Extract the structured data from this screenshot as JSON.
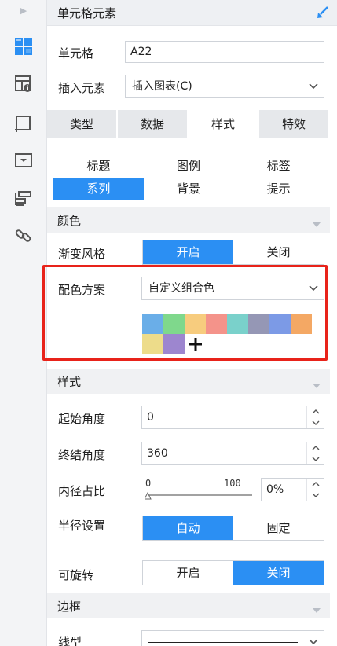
{
  "rail": {
    "icons": [
      "collapse-arrow-icon",
      "cell-grid-icon",
      "cell-attribute-icon",
      "widget-frame-icon",
      "form-element-icon",
      "layout-stack-icon",
      "link-icon"
    ]
  },
  "header": {
    "title": "单元格元素"
  },
  "cell": {
    "label": "单元格",
    "value": "A22"
  },
  "insert": {
    "label": "插入元素",
    "value": "插入图表(C)"
  },
  "main_tabs": [
    {
      "label": "类型",
      "active": false
    },
    {
      "label": "数据",
      "active": false
    },
    {
      "label": "样式",
      "active": true
    },
    {
      "label": "特效",
      "active": false
    }
  ],
  "sub_tabs": [
    {
      "label": "标题",
      "active": false
    },
    {
      "label": "图例",
      "active": false
    },
    {
      "label": "标签",
      "active": false
    },
    {
      "label": "系列",
      "active": true
    },
    {
      "label": "背景",
      "active": false
    },
    {
      "label": "提示",
      "active": false
    }
  ],
  "color_section": {
    "title": "颜色"
  },
  "gradient": {
    "label": "渐变风格",
    "on": "开启",
    "off": "关闭",
    "selected": "on"
  },
  "scheme": {
    "label": "配色方案",
    "value": "自定义组合色"
  },
  "palette": [
    "#6aaee8",
    "#7fd88c",
    "#f7cc7e",
    "#f4938a",
    "#7ad1cb",
    "#9597b5",
    "#7c9ae6",
    "#f4a864",
    "#eddc8a",
    "#9d86cf"
  ],
  "style_section": {
    "title": "样式"
  },
  "start_angle": {
    "label": "起始角度",
    "value": "0"
  },
  "end_angle": {
    "label": "终结角度",
    "value": "360"
  },
  "inner_radius": {
    "label": "内径占比",
    "min": "0",
    "max": "100",
    "value": "0%"
  },
  "radius": {
    "label": "半径设置",
    "auto": "自动",
    "fixed": "固定",
    "selected": "auto"
  },
  "rotate": {
    "label": "可旋转",
    "on": "开启",
    "off": "关闭",
    "selected": "off"
  },
  "border_section": {
    "title": "边框"
  },
  "line_type": {
    "label": "线型"
  },
  "colors": {
    "accent": "#2b8ff3",
    "highlight": "#e8231a"
  }
}
